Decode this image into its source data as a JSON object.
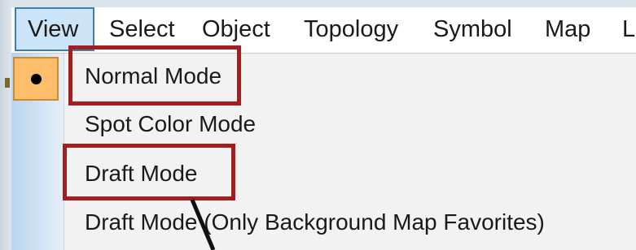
{
  "menubar": {
    "items": [
      {
        "label": "View",
        "active": true
      },
      {
        "label": "Select"
      },
      {
        "label": "Object"
      },
      {
        "label": "Topology"
      },
      {
        "label": "Symbol"
      },
      {
        "label": "Map"
      },
      {
        "label": "L"
      }
    ]
  },
  "view_menu": {
    "selected": "Normal Mode",
    "options": [
      {
        "label": "Normal Mode",
        "checked": true
      },
      {
        "label": "Spot Color Mode"
      },
      {
        "label": "Draft Mode"
      },
      {
        "label": "Draft Mode (Only Background Map Favorites)"
      }
    ]
  },
  "colors": {
    "annotation_red": "#a31f1f",
    "check_highlight": "#fdbe6b",
    "active_menu_bg": "#cce4f7"
  }
}
